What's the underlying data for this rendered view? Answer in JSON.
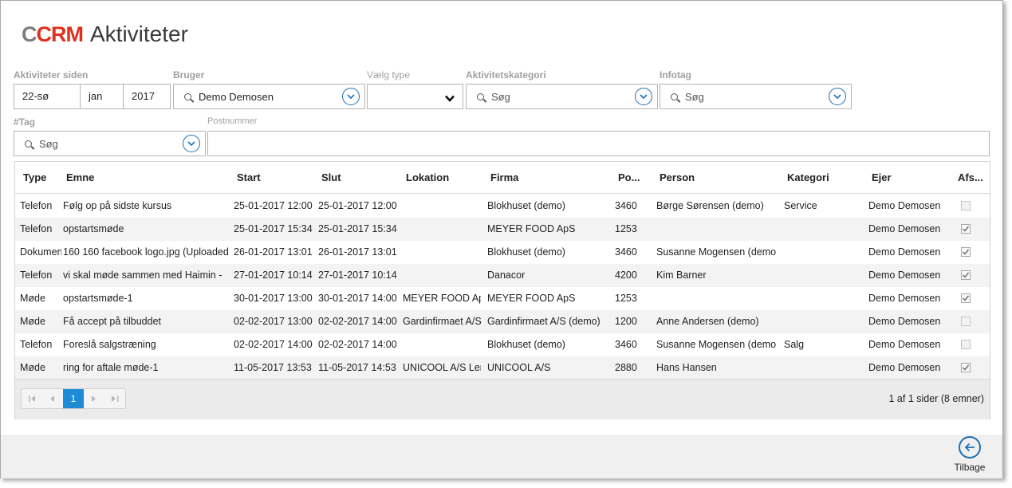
{
  "header": {
    "logo_c": "C",
    "logo_crm": "CRM",
    "title": "Aktiviteter"
  },
  "filters": {
    "since": {
      "label": "Aktiviteter siden",
      "day": "22-sø",
      "month": "jan",
      "year": "2017"
    },
    "user": {
      "label": "Bruger",
      "value": "Demo Demosen"
    },
    "type": {
      "label": "Vælg type",
      "value": ""
    },
    "category": {
      "label": "Aktivitetskategori",
      "placeholder": "Søg"
    },
    "infotag": {
      "label": "Infotag",
      "placeholder": "Søg"
    },
    "tag": {
      "label": "#Tag",
      "placeholder": "Søg"
    },
    "postal": {
      "label": "Postnummer",
      "value": ""
    }
  },
  "grid": {
    "columns": [
      "Type",
      "Emne",
      "Start",
      "Slut",
      "Lokation",
      "Firma",
      "Po...",
      "Person",
      "Kategori",
      "Ejer",
      "Afs..."
    ],
    "rows": [
      {
        "type": "Telefon",
        "subject": "Følg op på sidste kursus",
        "start": "25-01-2017 12:00",
        "end": "25-01-2017 12:00",
        "location": "",
        "company": "Blokhuset (demo)",
        "postal": "3460",
        "person": "Børge Sørensen (demo)",
        "category": "Service",
        "owner": "Demo Demosen",
        "done": false
      },
      {
        "type": "Telefon",
        "subject": "opstartsmøde",
        "start": "25-01-2017 15:34",
        "end": "25-01-2017 15:34",
        "location": "",
        "company": "MEYER FOOD ApS",
        "postal": "1253",
        "person": "",
        "category": "",
        "owner": "Demo Demosen",
        "done": true
      },
      {
        "type": "Dokumen",
        "subject": "160 160 facebook logo.jpg (Uploaded",
        "start": "26-01-2017 13:01",
        "end": "26-01-2017 13:01",
        "location": "",
        "company": "Blokhuset (demo)",
        "postal": "3460",
        "person": "Susanne Mogensen (demo",
        "category": "",
        "owner": "Demo Demosen",
        "done": true
      },
      {
        "type": "Telefon",
        "subject": "vi skal møde sammen med Haimin -",
        "start": "27-01-2017 10:14",
        "end": "27-01-2017 10:14",
        "location": "",
        "company": "Danacor",
        "postal": "4200",
        "person": "Kim Barner",
        "category": "",
        "owner": "Demo Demosen",
        "done": true
      },
      {
        "type": "Møde",
        "subject": "opstartsmøde-1",
        "start": "30-01-2017 13:00",
        "end": "30-01-2017 14:00",
        "location": "MEYER FOOD ApS",
        "company": "MEYER FOOD ApS",
        "postal": "1253",
        "person": "",
        "category": "",
        "owner": "Demo Demosen",
        "done": true
      },
      {
        "type": "Møde",
        "subject": "Få accept på tilbuddet",
        "start": "02-02-2017 13:00",
        "end": "02-02-2017 14:00",
        "location": "Gardinfirmaet A/S",
        "company": "Gardinfirmaet A/S (demo)",
        "postal": "1200",
        "person": "Anne Andersen (demo)",
        "category": "",
        "owner": "Demo Demosen",
        "done": false
      },
      {
        "type": "Telefon",
        "subject": "Foreslå salgstræning",
        "start": "02-02-2017 14:00",
        "end": "02-02-2017 14:00",
        "location": "",
        "company": "Blokhuset (demo)",
        "postal": "3460",
        "person": "Susanne Mogensen (demo",
        "category": "Salg",
        "owner": "Demo Demosen",
        "done": false
      },
      {
        "type": "Møde",
        "subject": "ring for aftale møde-1",
        "start": "11-05-2017 13:53",
        "end": "11-05-2017 14:53",
        "location": "UNICOOL A/S Lem",
        "company": "UNICOOL A/S",
        "postal": "2880",
        "person": "Hans Hansen",
        "category": "",
        "owner": "Demo Demosen",
        "done": true
      }
    ]
  },
  "pager": {
    "current_page": "1",
    "info": "1 af 1 sider (8 emner)"
  },
  "footer": {
    "back_label": "Tilbage"
  },
  "colors": {
    "accent": "#1c6fb5",
    "active_page": "#1d8bd6",
    "logo_red": "#e0301e",
    "logo_grey": "#7d7d7d"
  }
}
